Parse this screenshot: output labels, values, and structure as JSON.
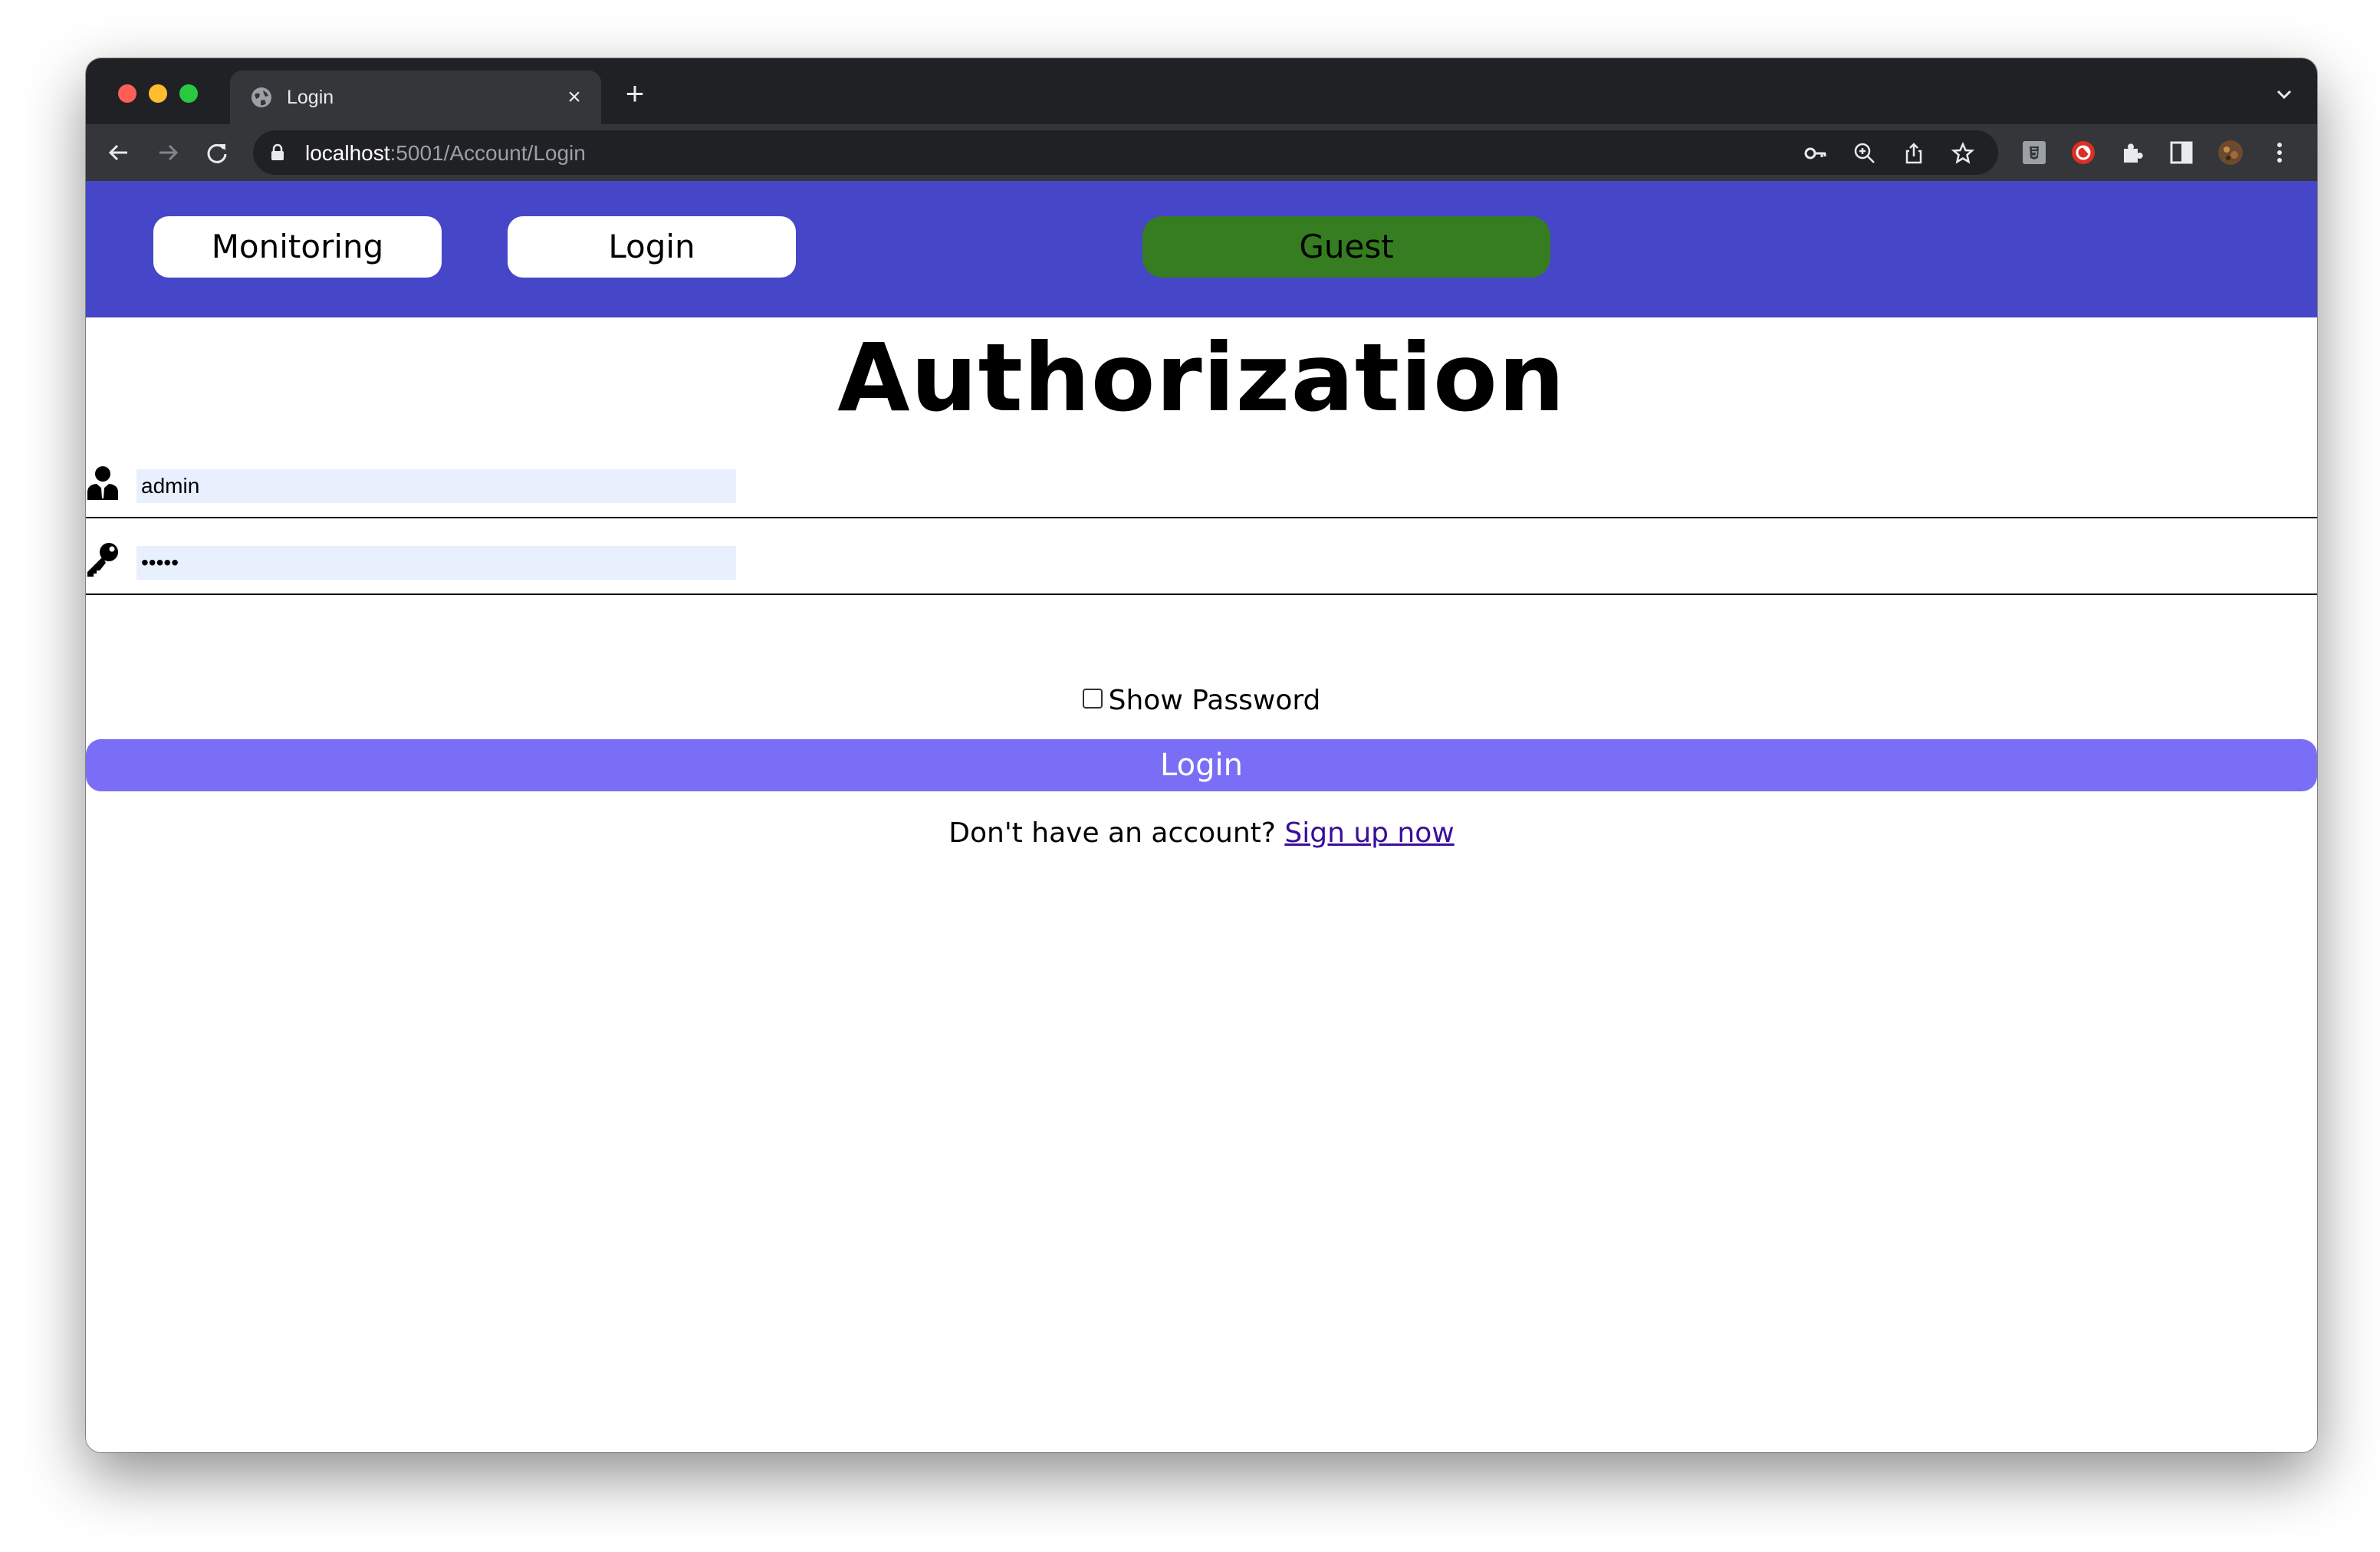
{
  "browser": {
    "tab_title": "Login",
    "url_host": "localhost",
    "url_path": ":5001/Account/Login"
  },
  "nav": {
    "monitoring_label": "Monitoring",
    "login_label": "Login",
    "user_badge": "Guest"
  },
  "page": {
    "heading": "Authorization",
    "username_value": "admin",
    "password_value": "•••••",
    "show_password_label": "Show Password",
    "login_button": "Login",
    "signup_prompt": "Don't have an account?",
    "signup_link": "Sign up now"
  },
  "colors": {
    "navbar_bg": "#4646c8",
    "guest_badge_bg": "#357d20",
    "login_button_bg": "#7b6ef6",
    "input_bg": "#e8f0fe",
    "link_color": "#3a0e9a"
  },
  "icons": {
    "username_field": "user-icon",
    "password_field": "key-icon"
  }
}
